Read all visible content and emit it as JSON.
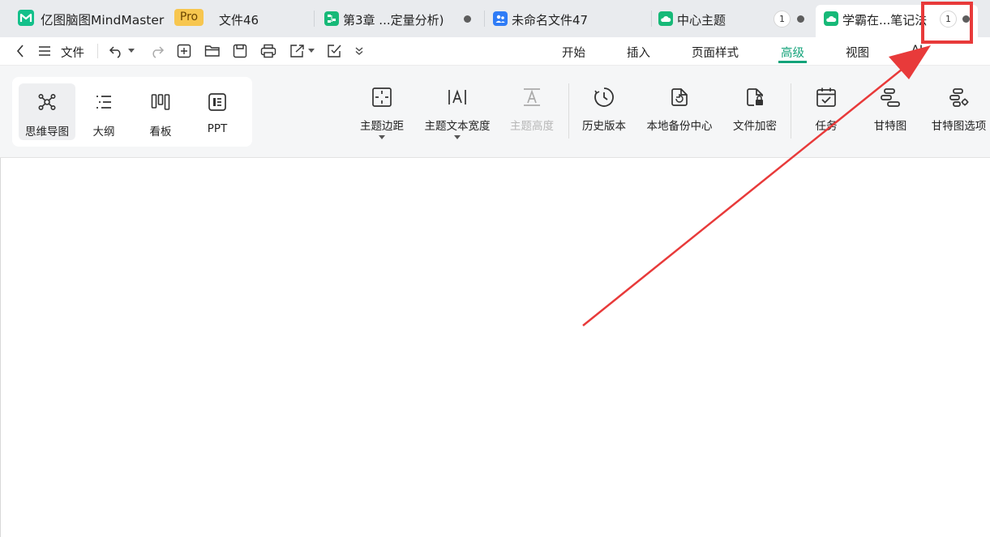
{
  "app": {
    "name": "亿图脑图MindMaster",
    "badge": "Pro"
  },
  "tabs": [
    {
      "label": "文件46"
    },
    {
      "label": "第3章 ...定量分析)"
    },
    {
      "label": "未命名文件47"
    },
    {
      "label": "中心主题",
      "badge": "1"
    },
    {
      "label": "学霸在...笔记法",
      "badge": "1",
      "active": true
    }
  ],
  "menubar": {
    "file": "文件",
    "tabs": [
      "开始",
      "插入",
      "页面样式",
      "高级",
      "视图",
      "AI"
    ],
    "active_tab": "高级"
  },
  "views": [
    "思维导图",
    "大纲",
    "看板",
    "PPT"
  ],
  "ribbon": {
    "topic_padding": "主题边距",
    "topic_text_width": "主题文本宽度",
    "topic_height": "主题高度",
    "history": "历史版本",
    "local_backup": "本地备份中心",
    "encrypt": "文件加密",
    "task": "任务",
    "gantt": "甘特图",
    "gantt_options": "甘特图选项"
  },
  "colors": {
    "accent": "#13a37a",
    "annotation": "#e83a3a",
    "pro": "#f7c64f"
  }
}
